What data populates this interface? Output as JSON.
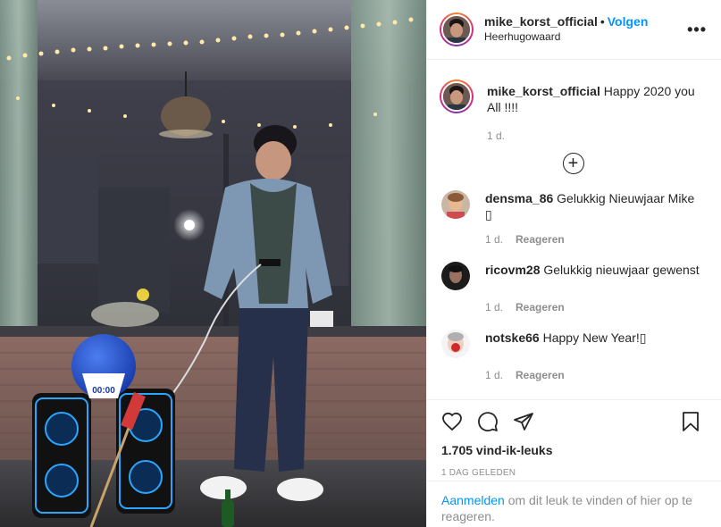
{
  "header": {
    "username": "mike_korst_official",
    "separator": "•",
    "follow_label": "Volgen",
    "location": "Heerhugowaard",
    "more_icon": "more-options-icon",
    "more_label": "•••"
  },
  "caption": {
    "username": "mike_korst_official",
    "text": "Happy 2020 you All !!!!",
    "time": "1 d."
  },
  "load_more": {
    "icon": "plus-circle-icon",
    "label": "+"
  },
  "comments": [
    {
      "username": "densma_86",
      "text": "Gelukkig Nieuwjaar Mike",
      "emoji": "▯",
      "time": "1 d.",
      "reply": "Reageren"
    },
    {
      "username": "ricovm28",
      "text": "Gelukkig nieuwjaar gewenst",
      "time": "1 d.",
      "reply": "Reageren"
    },
    {
      "username": "notske66",
      "text": "Happy New Year!▯",
      "time": "1 d.",
      "reply": "Reageren"
    }
  ],
  "actions": {
    "like_icon": "heart-icon",
    "comment_icon": "comment-icon",
    "share_icon": "send-icon",
    "save_icon": "bookmark-icon"
  },
  "likes": "1.705 vind-ik-leuks",
  "date": "1 DAG GELEDEN",
  "login": {
    "link": "Aanmelden",
    "text": " om dit leuk te vinden of hier op te reageren."
  },
  "photo": {
    "balloon_text": "00:00"
  },
  "colors": {
    "accent": "#0095f6",
    "text": "#262626",
    "muted": "#8e8e8e",
    "border": "#efefef"
  }
}
